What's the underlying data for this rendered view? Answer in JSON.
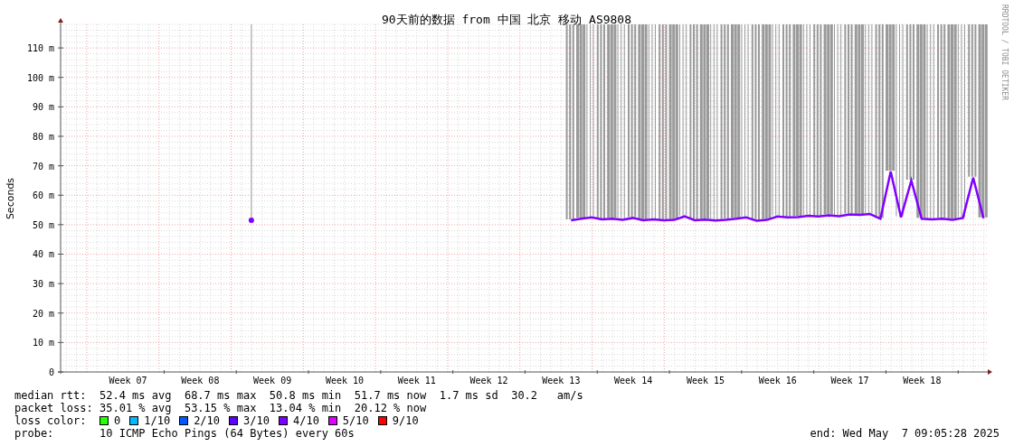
{
  "graph": {
    "credit": "RRDTOOL / TOBI OETIKER",
    "chart_data": {
      "type": "line",
      "title": "90天前的数据 from 中国 北京 移动 AS9808",
      "ylabel": "Seconds",
      "ylim": [
        0,
        118
      ],
      "grid": true,
      "yticks": [
        {
          "value": 0,
          "label": "0"
        },
        {
          "value": 10,
          "label": "10 m"
        },
        {
          "value": 20,
          "label": "20 m"
        },
        {
          "value": 30,
          "label": "30 m"
        },
        {
          "value": 40,
          "label": "40 m"
        },
        {
          "value": 50,
          "label": "50 m"
        },
        {
          "value": 60,
          "label": "60 m"
        },
        {
          "value": 70,
          "label": "70 m"
        },
        {
          "value": 80,
          "label": "80 m"
        },
        {
          "value": 90,
          "label": "90 m"
        },
        {
          "value": 100,
          "label": "100 m"
        },
        {
          "value": 110,
          "label": "110 m"
        }
      ],
      "categories": [
        null,
        null,
        null,
        null,
        null,
        null,
        "Week 07",
        null,
        null,
        null,
        null,
        null,
        null,
        "Week 08",
        null,
        null,
        null,
        null,
        null,
        null,
        "Week 09",
        null,
        null,
        null,
        null,
        null,
        null,
        "Week 10",
        null,
        null,
        null,
        null,
        null,
        null,
        "Week 11",
        null,
        null,
        null,
        null,
        null,
        null,
        "Week 12",
        null,
        null,
        null,
        null,
        null,
        null,
        "Week 13",
        null,
        null,
        null,
        null,
        null,
        null,
        "Week 14",
        null,
        null,
        null,
        null,
        null,
        null,
        "Week 15",
        null,
        null,
        null,
        null,
        null,
        null,
        "Week 16",
        null,
        null,
        null,
        null,
        null,
        null,
        "Week 17",
        null,
        null,
        null,
        null,
        null,
        null,
        "Week 18",
        null,
        null,
        null,
        null,
        null,
        null
      ],
      "series": [
        {
          "color": "#8000ff",
          "values": [
            null,
            null,
            null,
            null,
            null,
            null,
            null,
            null,
            null,
            null,
            null,
            null,
            null,
            null,
            null,
            null,
            null,
            null,
            51.5,
            null,
            null,
            null,
            null,
            null,
            null,
            null,
            null,
            null,
            null,
            null,
            null,
            null,
            null,
            null,
            null,
            null,
            null,
            null,
            null,
            null,
            null,
            null,
            null,
            null,
            null,
            null,
            null,
            null,
            null,
            51.5,
            52,
            52.5,
            51.8,
            52,
            51.6,
            52.3,
            51.5,
            51.8,
            51.5,
            51.6,
            52.8,
            51.5,
            51.7,
            51.4,
            51.6,
            52,
            52.5,
            51.3,
            51.6,
            52.8,
            52.5,
            52.6,
            53,
            52.8,
            53.2,
            52.9,
            53.5,
            53.3,
            53.6,
            52,
            68,
            52.5,
            65,
            52,
            51.8,
            52,
            51.6,
            52.3,
            66,
            52.2
          ]
        }
      ]
    }
  },
  "legend": {
    "rtt": {
      "label": "median rtt:",
      "text": "52.4 ms avg  68.7 ms max  50.8 ms min  51.7 ms now  1.7 ms sd  30.2   am/s"
    },
    "loss": {
      "label": "packet loss:",
      "text": "35.01 % avg  53.15 % max  13.04 % min  20.12 % now"
    },
    "loss_color_label": "loss color:",
    "loss_colors": [
      {
        "label": "0",
        "color": "#26ff00"
      },
      {
        "label": "1/10",
        "color": "#00b8ff"
      },
      {
        "label": "2/10",
        "color": "#0059ff"
      },
      {
        "label": "3/10",
        "color": "#5e00ff"
      },
      {
        "label": "4/10",
        "color": "#7e00ff"
      },
      {
        "label": "5/10",
        "color": "#dd00ff"
      },
      {
        "label": "9/10",
        "color": "#ff0000"
      }
    ],
    "probe": {
      "label": "probe:",
      "text": "10 ICMP Echo Pings (64 Bytes) every 60s"
    },
    "end": "end: Wed May  7 09:05:28 2025"
  }
}
